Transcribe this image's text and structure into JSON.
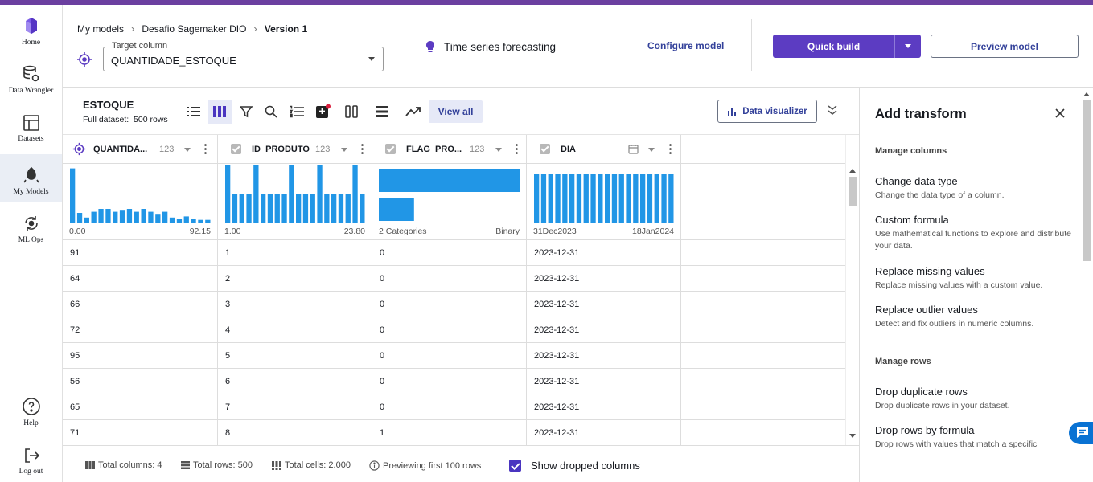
{
  "colors": {
    "accent": "#5c3cc2",
    "link": "#33419a",
    "bar": "#2196e6",
    "topbar": "#6b3fa0"
  },
  "nav": {
    "items": [
      {
        "label": "Home",
        "icon": "home-logo-icon"
      },
      {
        "label": "Data Wrangler",
        "icon": "data-wrangler-icon"
      },
      {
        "label": "Datasets",
        "icon": "datasets-icon"
      },
      {
        "label": "My Models",
        "icon": "my-models-icon"
      },
      {
        "label": "ML Ops",
        "icon": "ml-ops-icon"
      }
    ],
    "help": "Help",
    "logout": "Log out"
  },
  "header": {
    "breadcrumb": [
      "My models",
      "Desafio Sagemaker DIO",
      "Version 1"
    ],
    "target_label": "Target column",
    "target_value": "QUANTIDADE_ESTOQUE",
    "problem_type": "Time series forecasting",
    "configure": "Configure model",
    "quick_build": "Quick build",
    "preview": "Preview model"
  },
  "toolbar": {
    "dataset_name": "ESTOQUE",
    "full_dataset_label": "Full dataset:",
    "rows": "500 rows",
    "view_all": "View all",
    "data_visualizer": "Data visualizer"
  },
  "columns": [
    {
      "name": "QUANTIDA...",
      "type": "123",
      "icon": "target-icon",
      "min": "0.00",
      "max": "92.15",
      "hist": [
        0.95,
        0.18,
        0.1,
        0.2,
        0.25,
        0.25,
        0.2,
        0.22,
        0.25,
        0.2,
        0.25,
        0.2,
        0.15,
        0.2,
        0.1,
        0.08,
        0.12,
        0.08,
        0.06,
        0.06
      ]
    },
    {
      "name": "ID_PRODUTO",
      "type": "123",
      "icon": "checkbox",
      "min": "1.00",
      "max": "23.80",
      "hist": [
        1,
        0.5,
        0.5,
        0.5,
        1,
        0.5,
        0.5,
        0.5,
        0.5,
        1,
        0.5,
        0.5,
        0.5,
        1,
        0.5,
        0.5,
        0.5,
        0.5,
        1,
        0.5
      ]
    },
    {
      "name": "FLAG_PRO...",
      "type": "123",
      "icon": "checkbox",
      "min": "2 Categories",
      "max": "Binary",
      "cats": [
        1.0,
        0.25
      ]
    },
    {
      "name": "DIA",
      "type": "date",
      "icon": "checkbox",
      "min": "31Dec2023",
      "max": "18Jan2024",
      "hist": [
        0.85,
        0.85,
        0.85,
        0.85,
        0.85,
        0.85,
        0.85,
        0.85,
        0.85,
        0.85,
        0.85,
        0.85,
        0.85,
        0.85,
        0.85,
        0.85,
        0.85,
        0.85,
        0.85,
        0.85
      ]
    }
  ],
  "rows": [
    [
      "91",
      "1",
      "0",
      "2023-12-31"
    ],
    [
      "64",
      "2",
      "0",
      "2023-12-31"
    ],
    [
      "66",
      "3",
      "0",
      "2023-12-31"
    ],
    [
      "72",
      "4",
      "0",
      "2023-12-31"
    ],
    [
      "95",
      "5",
      "0",
      "2023-12-31"
    ],
    [
      "56",
      "6",
      "0",
      "2023-12-31"
    ],
    [
      "65",
      "7",
      "0",
      "2023-12-31"
    ],
    [
      "71",
      "8",
      "1",
      "2023-12-31"
    ]
  ],
  "footer": {
    "total_columns": "Total columns: 4",
    "total_rows": "Total rows: 500",
    "total_cells": "Total cells: 2.000",
    "previewing": "Previewing first 100 rows",
    "show_dropped": "Show dropped columns"
  },
  "panel": {
    "title": "Add transform",
    "sections": [
      {
        "heading": "Manage columns",
        "items": [
          {
            "title": "Change data type",
            "desc": "Change the data type of a column."
          },
          {
            "title": "Custom formula",
            "desc": "Use mathematical functions to explore and distribute your data."
          },
          {
            "title": "Replace missing values",
            "desc": "Replace missing values with a custom value."
          },
          {
            "title": "Replace outlier values",
            "desc": "Detect and fix outliers in numeric columns."
          }
        ]
      },
      {
        "heading": "Manage rows",
        "items": [
          {
            "title": "Drop duplicate rows",
            "desc": "Drop duplicate rows in your dataset."
          },
          {
            "title": "Drop rows by formula",
            "desc": "Drop rows with values that match a specific"
          }
        ]
      }
    ]
  }
}
